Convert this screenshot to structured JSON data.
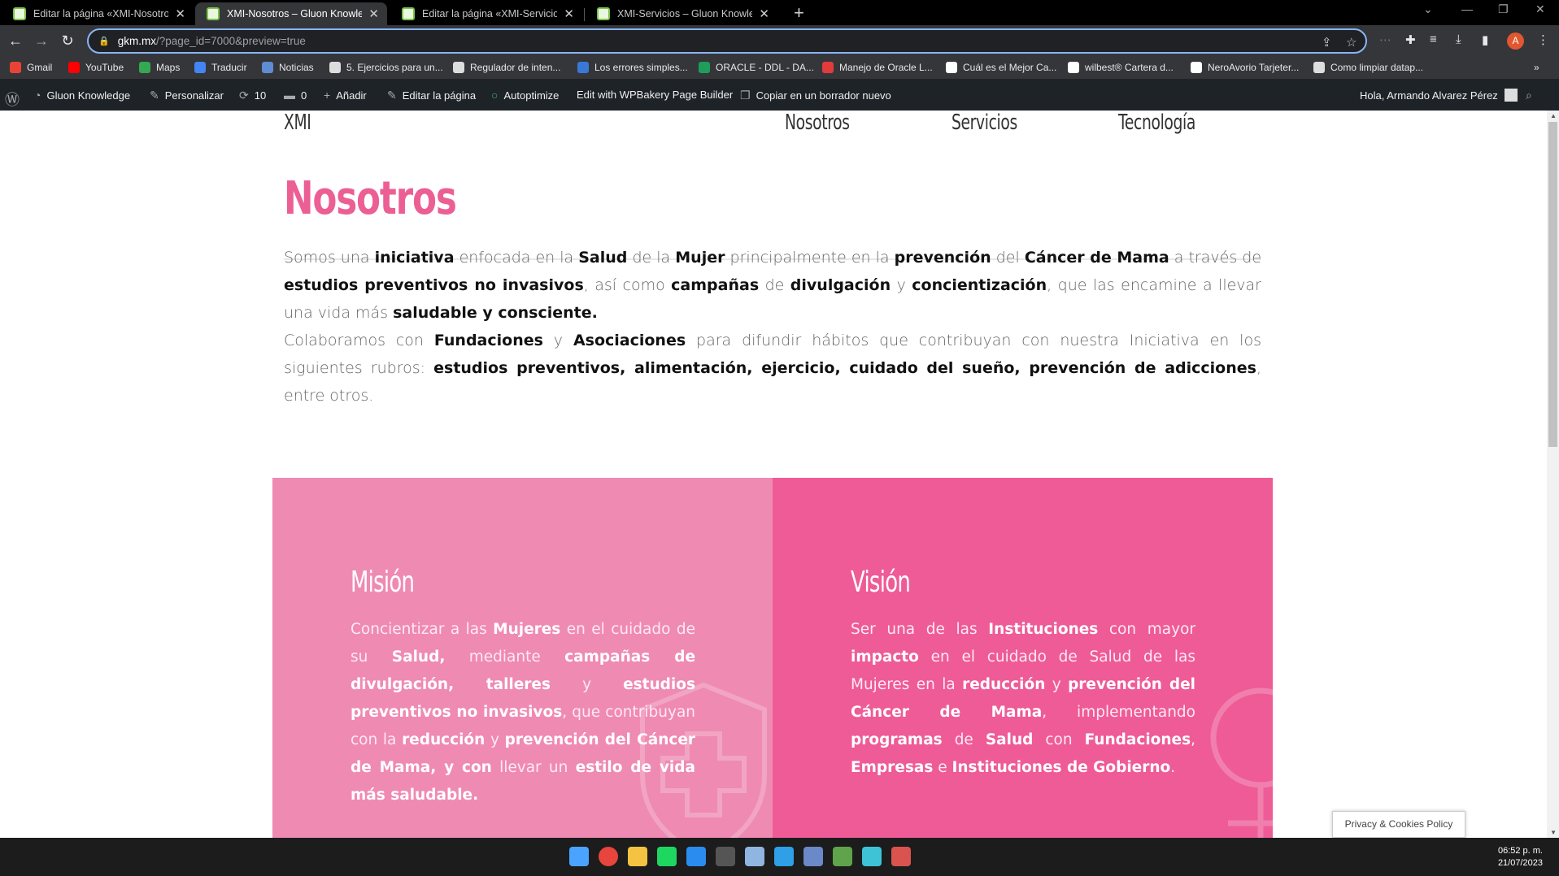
{
  "tabs": [
    {
      "title": "Editar la página «XMI-Nosotros» ...",
      "active": false
    },
    {
      "title": "XMI-Nosotros – Gluon Knowledge",
      "active": true
    },
    {
      "title": "Editar la página «XMI-Servicios» ...",
      "active": false
    },
    {
      "title": "XMI-Servicios – Gluon Knowledge",
      "active": false
    }
  ],
  "address": {
    "host": "gkm.mx",
    "path": "/?page_id=7000&preview=true"
  },
  "bookmarks": [
    {
      "label": "Gmail",
      "color": "#ea4335"
    },
    {
      "label": "YouTube",
      "color": "#ff0000"
    },
    {
      "label": "Maps",
      "color": "#34a853"
    },
    {
      "label": "Traducir",
      "color": "#4285f4"
    },
    {
      "label": "Noticias",
      "color": "#5f8dd3"
    },
    {
      "label": "5. Ejercicios para un...",
      "color": "#dddddd"
    },
    {
      "label": "Regulador de inten...",
      "color": "#dddddd"
    },
    {
      "label": "Los errores simples...",
      "color": "#3a78d8"
    },
    {
      "label": "ORACLE - DDL - DA...",
      "color": "#1e9e5a"
    },
    {
      "label": "Manejo de Oracle L...",
      "color": "#e23b3b"
    },
    {
      "label": "Cuál es el Mejor Ca...",
      "color": "#ffffff"
    },
    {
      "label": "wilbest® Cartera d...",
      "color": "#ffffff"
    },
    {
      "label": "NeroAvorio Tarjeter...",
      "color": "#ffffff"
    },
    {
      "label": "Como limpiar datap...",
      "color": "#dddddd"
    }
  ],
  "adminbar": {
    "site": "Gluon Knowledge",
    "customize": "Personalizar",
    "updates": "10",
    "comments": "0",
    "add": "Añadir",
    "edit": "Editar la página",
    "autoptimize": "Autoptimize",
    "wpbakery": "Edit with WPBakery Page Builder",
    "copy_draft": "Copiar en un borrador nuevo",
    "greeting": "Hola, Armando Alvarez Pérez"
  },
  "site": {
    "logo": "XMI",
    "nav": [
      "Nosotros",
      "Servicios",
      "Tecnología"
    ]
  },
  "page": {
    "title": "Nosotros",
    "p1": [
      {
        "t": "Somos una ",
        "b": false
      },
      {
        "t": "iniciativa",
        "b": true
      },
      {
        "t": " enfocada en la ",
        "b": false
      },
      {
        "t": "Salud",
        "b": true
      },
      {
        "t": " de la ",
        "b": false
      },
      {
        "t": "Mujer",
        "b": true
      },
      {
        "t": " principalmente en la ",
        "b": false
      },
      {
        "t": "prevención",
        "b": true
      },
      {
        "t": " del ",
        "b": false
      },
      {
        "t": "Cáncer de Mama",
        "b": true
      },
      {
        "t": " a través de ",
        "b": false
      },
      {
        "t": "estudios preventivos no invasivos",
        "b": true
      },
      {
        "t": ", así como ",
        "b": false
      },
      {
        "t": "campañas",
        "b": true
      },
      {
        "t": " de ",
        "b": false
      },
      {
        "t": "divulgación",
        "b": true
      },
      {
        "t": " y ",
        "b": false
      },
      {
        "t": "concientización",
        "b": true
      },
      {
        "t": ", que las encamine a llevar una vida más ",
        "b": false
      },
      {
        "t": "saludable y consciente.",
        "b": true
      }
    ],
    "p2": [
      {
        "t": "Colaboramos con ",
        "b": false
      },
      {
        "t": "Fundaciones",
        "b": true
      },
      {
        "t": " y ",
        "b": false
      },
      {
        "t": "Asociaciones",
        "b": true
      },
      {
        "t": " para difundir hábitos que contribuyan con nuestra Iniciativa en los siguientes rubros: ",
        "b": false
      },
      {
        "t": "estudios preventivos, alimentación, ejercicio, cuidado del sueño, prevención de adicciones",
        "b": true
      },
      {
        "t": ", entre otros.",
        "b": false
      }
    ]
  },
  "mision": {
    "title": "Misión",
    "text": [
      {
        "t": "Concientizar a las ",
        "b": false
      },
      {
        "t": "Mujeres",
        "b": true
      },
      {
        "t": " en el cuidado de su ",
        "b": false
      },
      {
        "t": "Salud,",
        "b": true
      },
      {
        "t": " mediante ",
        "b": false
      },
      {
        "t": "campañas de divulgación, talleres",
        "b": true
      },
      {
        "t": " y ",
        "b": false
      },
      {
        "t": "estudios preventivos no invasivos",
        "b": true
      },
      {
        "t": ", que contribuyan con la ",
        "b": false
      },
      {
        "t": "reducción",
        "b": true
      },
      {
        "t": " y ",
        "b": false
      },
      {
        "t": "prevención del Cáncer de Mama, y con",
        "b": true
      },
      {
        "t": " llevar un ",
        "b": false
      },
      {
        "t": "estilo de vida más saludable.",
        "b": true
      }
    ]
  },
  "vision": {
    "title": "Visión",
    "text": [
      {
        "t": "Ser una de las ",
        "b": false
      },
      {
        "t": "Instituciones",
        "b": true
      },
      {
        "t": " con mayor ",
        "b": false
      },
      {
        "t": "impacto",
        "b": true
      },
      {
        "t": " en el cuidado de Salud de las Mujeres en la ",
        "b": false
      },
      {
        "t": "reducción",
        "b": true
      },
      {
        "t": " y ",
        "b": false
      },
      {
        "t": "prevención del Cáncer de Mama",
        "b": true
      },
      {
        "t": ", implementando ",
        "b": false
      },
      {
        "t": "programas",
        "b": true
      },
      {
        "t": " de ",
        "b": false
      },
      {
        "t": "Salud",
        "b": true
      },
      {
        "t": " con ",
        "b": false
      },
      {
        "t": "Fundaciones",
        "b": true
      },
      {
        "t": ", ",
        "b": false
      },
      {
        "t": "Empresas",
        "b": true
      },
      {
        "t": " e ",
        "b": false
      },
      {
        "t": "Instituciones de Gobierno",
        "b": true
      },
      {
        "t": ".",
        "b": false
      }
    ]
  },
  "privacy_button": "Privacy & Cookies Policy",
  "taskbar": {
    "time": "06:52 p. m.",
    "date": "21/07/2023",
    "apps": [
      {
        "name": "start",
        "color": "#4aa3ff"
      },
      {
        "name": "chrome",
        "color": "#e8453c"
      },
      {
        "name": "file-explorer",
        "color": "#f5c242"
      },
      {
        "name": "spotify",
        "color": "#1ed760"
      },
      {
        "name": "todo",
        "color": "#2b8cf0"
      },
      {
        "name": "terminal",
        "color": "#555555"
      },
      {
        "name": "monitor",
        "color": "#8fb5e0"
      },
      {
        "name": "vscode",
        "color": "#2f9fe8"
      },
      {
        "name": "remote-desktop",
        "color": "#6b88c8"
      },
      {
        "name": "game",
        "color": "#5fa34a"
      },
      {
        "name": "vpn",
        "color": "#3ec3d6"
      },
      {
        "name": "notes",
        "color": "#d9534f"
      }
    ]
  }
}
